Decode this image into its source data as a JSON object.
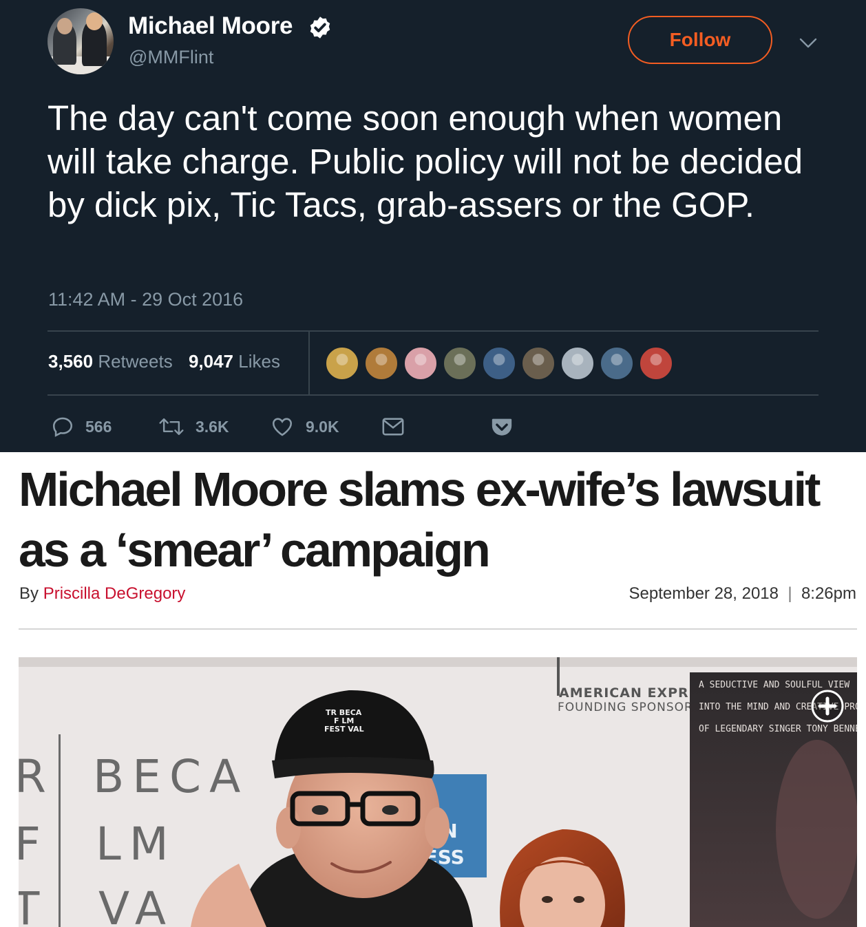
{
  "tweet": {
    "author_name": "Michael Moore",
    "author_handle": "@MMFlint",
    "follow_label": "Follow",
    "text": "The day can't come soon enough when women will take charge. Public policy will not be decided by dick pix, Tic Tacs, grab-assers or the GOP.",
    "timestamp": "11:42 AM - 29 Oct 2016",
    "retweets_count": "3,560",
    "retweets_label": "Retweets",
    "likes_count": "9,047",
    "likes_label": "Likes",
    "reply_count": "566",
    "retweet_short": "3.6K",
    "like_short": "9.0K",
    "liker_avatar_colors": [
      "#c9a24a",
      "#b07b3a",
      "#d9a0a8",
      "#6b6f58",
      "#3d5f86",
      "#6a5e4d",
      "#a8b3bd",
      "#4a6b8a",
      "#c0453c"
    ],
    "colors": {
      "background": "#15202b",
      "accent": "#f45d22",
      "muted": "#8899a6"
    }
  },
  "article": {
    "headline": "Michael Moore slams ex-wife’s lawsuit as a ‘smear’ campaign",
    "by_label": "By",
    "author": "Priscilla DeGregory",
    "date": "September 28, 2018",
    "separator": "|",
    "time": "8:26pm",
    "colors": {
      "author": "#c8102e"
    },
    "photo": {
      "backdrop_lines": [
        "R",
        "BECA",
        "F",
        "LM",
        "T",
        "VA"
      ],
      "cap_text": [
        "TR BECA",
        "F LM",
        "FEST VAL"
      ],
      "sponsor_lines": [
        "AMERICAN EXPR",
        "FOUNDING SPONSOR"
      ],
      "amex_fragment": [
        "CAN",
        "RESS"
      ],
      "poster_lines": [
        "A SEDUCTIVE AND SOULFUL VIEW",
        "INTO THE MIND AND CREATIVE PROCE",
        "OF LEGENDARY SINGER TONY BENNET"
      ]
    }
  }
}
